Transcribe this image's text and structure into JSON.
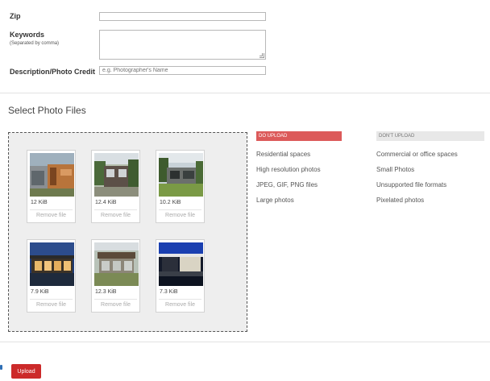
{
  "form": {
    "zip_label": "Zip",
    "zip_value": "",
    "keywords_label": "Keywords",
    "keywords_sublabel": "(Separated by comma)",
    "keywords_value": "",
    "description_label": "Description/Photo Credit",
    "description_placeholder": "e.g. Photographer's Name"
  },
  "section_title": "Select Photo Files",
  "photos": [
    {
      "size": "12 KiB",
      "remove_label": "Remove file"
    },
    {
      "size": "12.4 KiB",
      "remove_label": "Remove file"
    },
    {
      "size": "10.2 KiB",
      "remove_label": "Remove file"
    },
    {
      "size": "7.9 KiB",
      "remove_label": "Remove file"
    },
    {
      "size": "12.3 KiB",
      "remove_label": "Remove file"
    },
    {
      "size": "7.3 KiB",
      "remove_label": "Remove file"
    }
  ],
  "guidelines": {
    "do_header": "DO UPLOAD",
    "do_items": [
      "Residential spaces",
      "High resolution photos",
      "JPEG, GIF, PNG files",
      "Large photos"
    ],
    "dont_header": "DON'T UPLOAD",
    "dont_items": [
      "Commercial or office spaces",
      "Small Photos",
      "Unsupported file formats",
      "Pixelated photos"
    ]
  },
  "upload_label": "Upload",
  "colors": {
    "do_header_bg": "#dc5a5a",
    "dont_header_bg": "#e8e8e8",
    "upload_button_bg": "#cc2a2a"
  }
}
